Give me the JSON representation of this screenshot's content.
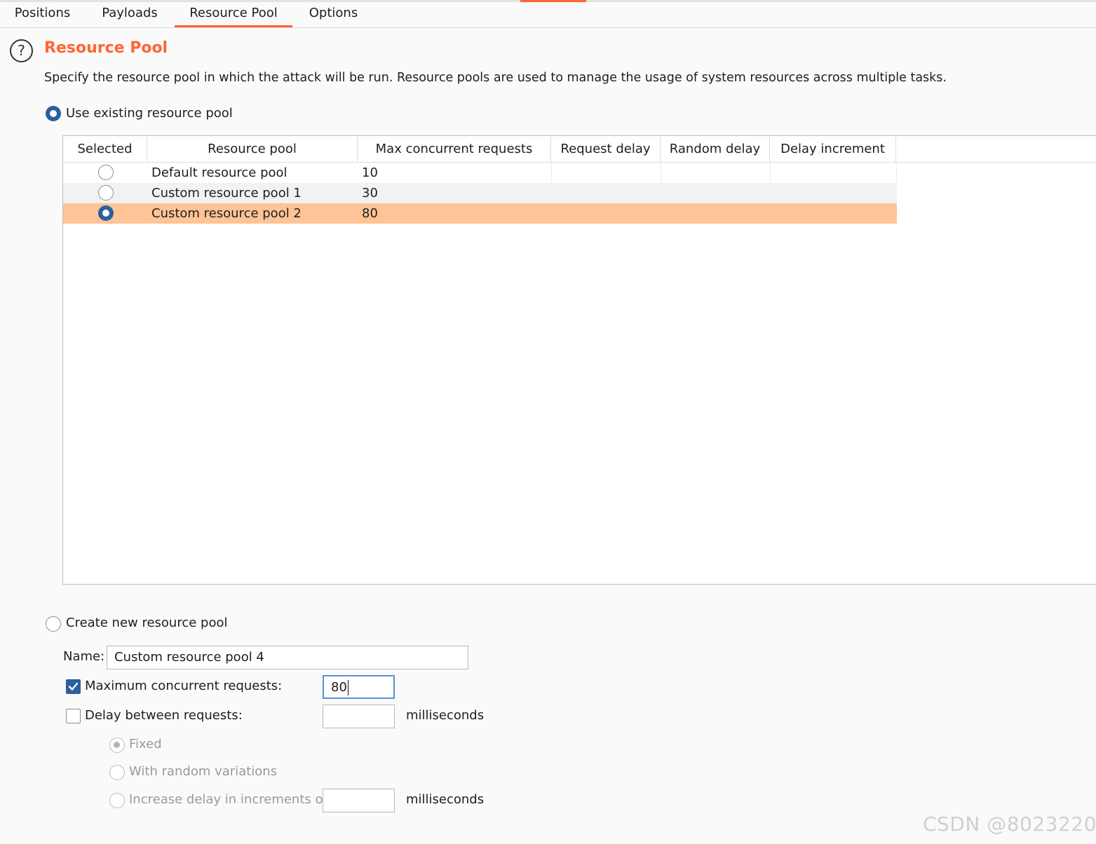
{
  "tabs": [
    {
      "label": "Positions"
    },
    {
      "label": "Payloads"
    },
    {
      "label": "Resource Pool"
    },
    {
      "label": "Options"
    }
  ],
  "active_tab": "Resource Pool",
  "section": {
    "title": "Resource Pool",
    "description": "Specify the resource pool in which the attack will be run. Resource pools are used to manage the usage of system resources across multiple tasks."
  },
  "use_existing": {
    "label": "Use existing resource pool",
    "selected": true
  },
  "table": {
    "columns": [
      "Selected",
      "Resource pool",
      "Max concurrent requests",
      "Request delay",
      "Random delay",
      "Delay increment"
    ],
    "rows": [
      {
        "selected": false,
        "name": "Default resource pool",
        "max": "10",
        "request_delay": "",
        "random_delay": "",
        "delay_increment": ""
      },
      {
        "selected": false,
        "name": "Custom resource pool 1",
        "max": "30",
        "request_delay": "",
        "random_delay": "",
        "delay_increment": ""
      },
      {
        "selected": true,
        "name": "Custom resource pool 2",
        "max": "80",
        "request_delay": "",
        "random_delay": "",
        "delay_increment": ""
      }
    ]
  },
  "create_new": {
    "label": "Create new resource pool",
    "selected": false,
    "name_label": "Name:",
    "name_value": "Custom resource pool 4",
    "max_concurrent": {
      "label": "Maximum concurrent requests:",
      "checked": true,
      "value": "80"
    },
    "delay": {
      "label": "Delay between requests:",
      "checked": false,
      "value": "",
      "unit": "milliseconds"
    },
    "fixed": {
      "label": "Fixed"
    },
    "random": {
      "label": "With random variations"
    },
    "increment": {
      "label": "Increase delay in increments of",
      "value": "",
      "unit": "milliseconds"
    }
  },
  "watermark": "CSDN @8023220",
  "colors": {
    "accent": "#ff6633",
    "selection": "#ffc495",
    "radio": "#2b5f9e"
  }
}
